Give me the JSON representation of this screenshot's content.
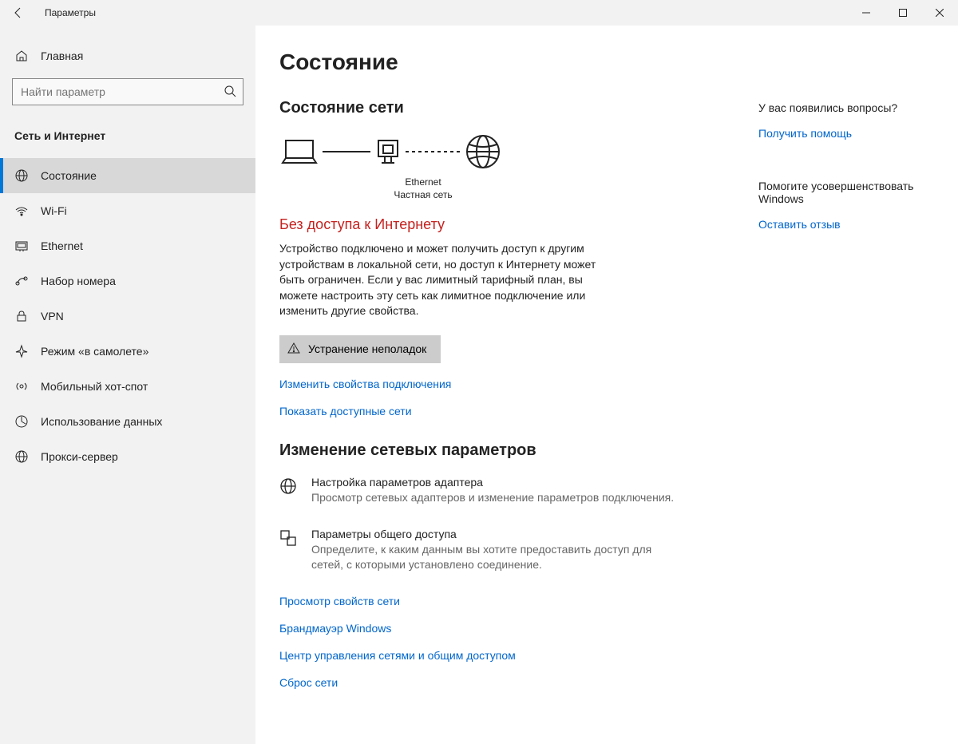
{
  "window": {
    "title": "Параметры"
  },
  "sidebar": {
    "home_label": "Главная",
    "search_placeholder": "Найти параметр",
    "category_title": "Сеть и Интернет",
    "items": [
      {
        "label": "Состояние",
        "active": true
      },
      {
        "label": "Wi-Fi"
      },
      {
        "label": "Ethernet"
      },
      {
        "label": "Набор номера"
      },
      {
        "label": "VPN"
      },
      {
        "label": "Режим «в самолете»"
      },
      {
        "label": "Мобильный хот-спот"
      },
      {
        "label": "Использование данных"
      },
      {
        "label": "Прокси-сервер"
      }
    ]
  },
  "content": {
    "page_title": "Состояние",
    "section1_title": "Состояние сети",
    "net_label1": "Ethernet",
    "net_label2": "Частная сеть",
    "alert_text": "Без доступа к Интернету",
    "desc_text": "Устройство подключено и может получить доступ к другим устройствам в локальной сети, но доступ к Интернету может быть ограничен. Если у вас лимитный тарифный план, вы можете настроить эту сеть как лимитное подключение или изменить другие свойства.",
    "troubleshoot_btn": "Устранение неполадок",
    "link_change_props": "Изменить свойства подключения",
    "link_show_nets": "Показать доступные сети",
    "section2_title": "Изменение сетевых параметров",
    "opt1_title": "Настройка параметров адаптера",
    "opt1_desc": "Просмотр сетевых адаптеров и изменение параметров подключения.",
    "opt2_title": "Параметры общего доступа",
    "opt2_desc": "Определите, к каким данным вы хотите предоставить доступ для сетей, с которыми установлено соединение.",
    "link_view_props": "Просмотр свойств сети",
    "link_firewall": "Брандмауэр Windows",
    "link_sharing_center": "Центр управления сетями и общим доступом",
    "link_reset": "Сброс сети"
  },
  "aside": {
    "q_text": "У вас появились вопросы?",
    "help_link": "Получить помощь",
    "feedback_text": "Помогите усовершенствовать Windows",
    "feedback_link": "Оставить отзыв"
  }
}
